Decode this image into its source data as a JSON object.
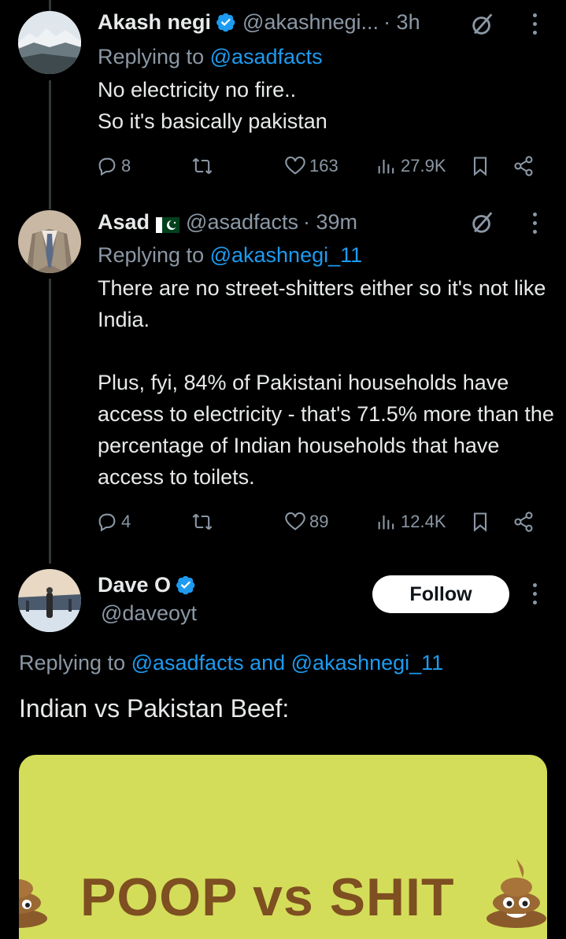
{
  "tweets": [
    {
      "name": "Akash negi",
      "handle": "@akashnegi...",
      "time": "· 3h",
      "replying_prefix": "Replying to ",
      "replying_to": "@asadfacts",
      "text": "No electricity no fire..\nSo it's basically pakistan",
      "replies": "8",
      "likes": "163",
      "views": "27.9K"
    },
    {
      "name": "Asad",
      "handle": "@asadfacts",
      "time": "· 39m",
      "replying_prefix": "Replying to ",
      "replying_to": "@akashnegi_11",
      "text": "There are no street-shitters either so it's not like India.\n\nPlus, fyi, 84% of Pakistani households have access to electricity - that's 71.5% more than the percentage of Indian households that have access to toilets.",
      "replies": "4",
      "likes": "89",
      "views": "12.4K"
    }
  ],
  "main_tweet": {
    "name": "Dave O",
    "handle": "@daveoyt",
    "follow_label": "Follow",
    "replying_prefix": "Replying to ",
    "replying_to_1": "@asadfacts",
    "and_text": " and ",
    "replying_to_2": "@akashnegi_11",
    "text": "Indian vs Pakistan Beef:",
    "image_text": "POOP vs SHIT"
  },
  "colors": {
    "background": "#000000",
    "link": "#1d9bf0",
    "secondary_text": "#8b98a5",
    "verified": "#1d9bf0",
    "meme_background": "#d4dd5a"
  },
  "icons": [
    "verified-icon",
    "grok-icon",
    "more-icon",
    "reply-icon",
    "retweet-icon",
    "like-icon",
    "views-icon",
    "bookmark-icon",
    "share-icon",
    "pakistan-flag-icon",
    "poop-emoji-icon"
  ]
}
